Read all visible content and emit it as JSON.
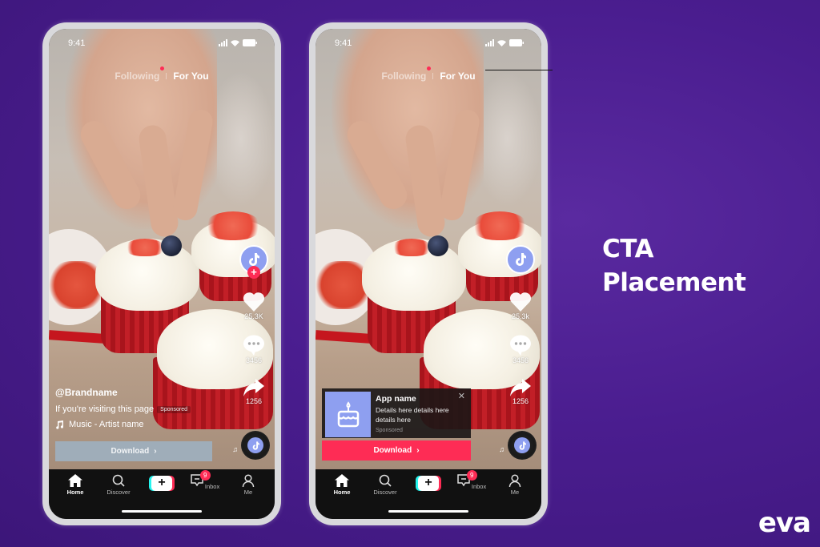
{
  "heading": {
    "line1": "CTA",
    "line2": "Placement"
  },
  "logo": {
    "text": "eva"
  },
  "colors": {
    "background": "#4a1d8f",
    "tiktok_red": "#fe2c55",
    "tiktok_cyan": "#25f4ee",
    "avatar_blue": "#8e9ff0",
    "grey_cta": "#9fadb9"
  },
  "phones": [
    {
      "status": {
        "time": "9:41"
      },
      "tabs": {
        "following": "Following",
        "for_you": "For You"
      },
      "rail": {
        "likes": "25.3K",
        "comments": "3456",
        "shares": "1256"
      },
      "caption": {
        "brandname": "@Brandname",
        "text": "If you're visiting this page",
        "sponsored": "Sponsored",
        "music": "Music - Artist name"
      },
      "cta": {
        "label": "Download",
        "chevron": "›"
      },
      "nav": {
        "home": "Home",
        "discover": "Discover",
        "inbox": "Inbox",
        "inbox_badge": "9",
        "me": "Me",
        "create": "+"
      }
    },
    {
      "status": {
        "time": "9:41"
      },
      "tabs": {
        "following": "Following",
        "for_you": "For You"
      },
      "rail": {
        "likes": "25.3k",
        "comments": "3456",
        "shares": "1256"
      },
      "ad": {
        "app_name": "App name",
        "details": "Details here details here details here",
        "sponsored": "Sponsored",
        "close": "✕"
      },
      "cta": {
        "label": "Download",
        "chevron": "›"
      },
      "nav": {
        "home": "Home",
        "discover": "Discover",
        "inbox": "Inbox",
        "inbox_badge": "9",
        "me": "Me",
        "create": "+"
      }
    }
  ]
}
